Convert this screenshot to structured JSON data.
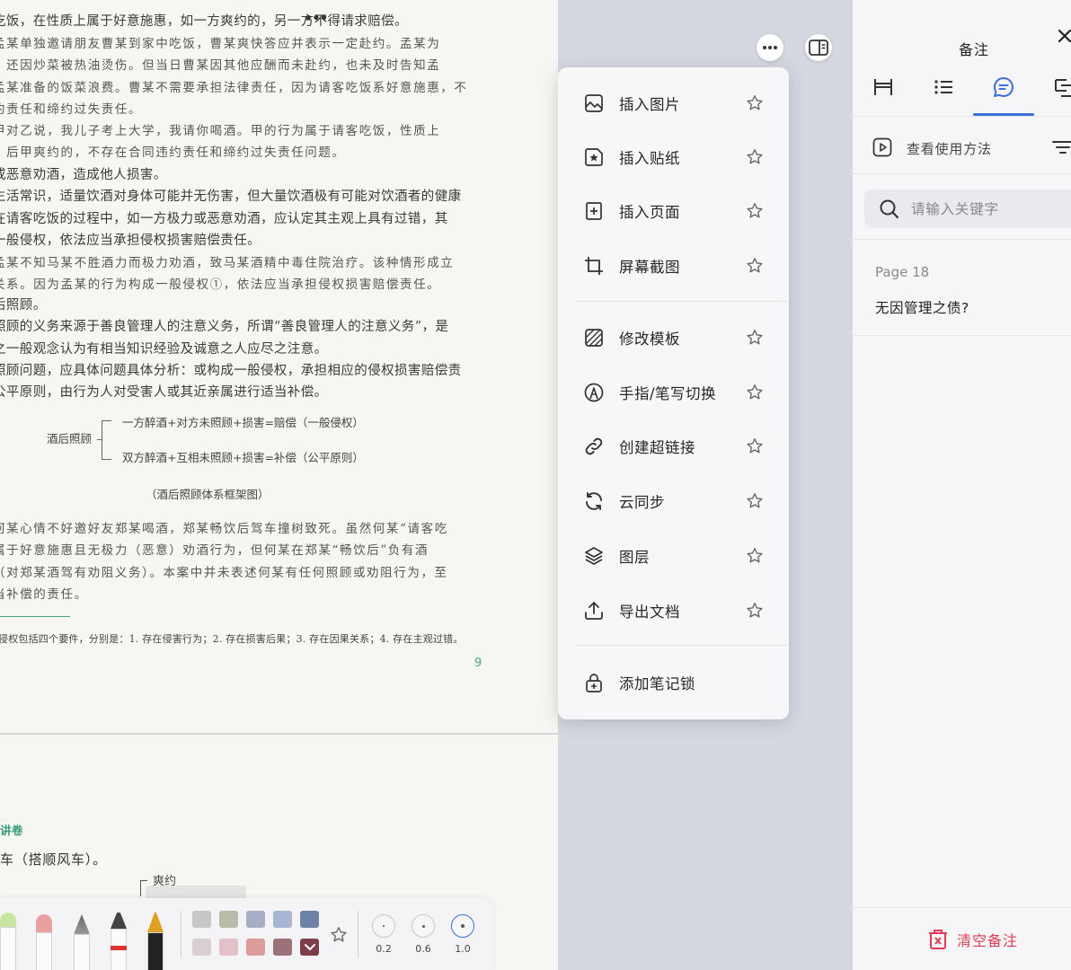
{
  "document": {
    "paragraphs": [
      {
        "text": "吃饭，在性质上属于好意施惠，如一方爽约的，另一方不得请求赔偿。",
        "hand": false
      },
      {
        "text": "孟某单独邀请朋友曹某到家中吃饭，曹某爽快答应并表示一定赴约。孟某为\n，还因炒菜被热油烫伤。但当日曹某因其他应酬而未赴约，也未及时告知孟\n孟某准备的饭菜浪费。曹某不需要承担法律责任，因为请客吃饭系好意施惠，不\n约责任和缔约过失责任。",
        "hand": true
      },
      {
        "text": "甲对乙说，我儿子考上大学，我请你喝酒。甲的行为属于请客吃饭，性质上\n。后甲爽约的，不存在合同违约责任和缔约过失责任问题。",
        "hand": true
      },
      {
        "text": "或恶意劝酒，造成他人损害。\n生活常识，适量饮酒对身体可能并无伤害，但大量饮酒极有可能对饮酒者的健康\n在请客吃饭的过程中，如一方极力或恶意劝酒，应认定其主观上具有过错，其\n一般侵权，依法应当承担侵权损害赔偿责任。",
        "hand": false
      },
      {
        "text": "孟某不知马某不胜酒力而极力劝酒，致马某酒精中毒住院治疗。该种情形成立\n关系。因为孟某的行为构成一般侵权①，依法应当承担侵权损害赔偿责任。",
        "hand": true
      },
      {
        "text": "后照顾。\n照顾的义务来源于善良管理人的注意义务，所谓“善良管理人的注意义务”，是\n之一般观念认为有相当知识经验及诚意之人应尽之注意。\n照顾问题，应具体问题具体分析：或构成一般侵权，承担相应的侵权损害赔偿责\n公平原则，由行为人对受害人或其近亲属进行适当补偿。",
        "hand": false
      },
      {
        "text": "何某心情不好邀好友郑某喝酒，郑某畅饮后驾车撞树致死。虽然何某“请客吃\n属于好意施惠且无极力（恶意）劝酒行为，但何某在郑某“畅饮后”负有酒\n（对郑某酒驾有劝阻义务）。本案中并未表述何某有任何照顾或劝阻行为，至\n当补偿的责任。",
        "hand": true
      }
    ],
    "diagram": {
      "root": "酒后照顾",
      "branch_a": "一方醉酒+对方未照顾+损害=赔偿（一般侵权）",
      "branch_b": "双方醉酒+互相未照顾+损害=补偿（公平原则）",
      "caption": "（酒后照顾体系框架图）"
    },
    "footnote": "侵权包括四个要件，分别是：1. 存在侵害行为；2. 存在损害后果；3. 存在因果关系；4. 存在主观过错。",
    "page_number": "9",
    "next_heading": "讲卷",
    "next_line": "车（搭顺风车）。",
    "margin_note": "爽约"
  },
  "pen_toolbar": {
    "colors_row1": [
      "#c7c7c7",
      "#b9bcab",
      "#a5aec4",
      "#a9b6d3",
      "#6d82a6"
    ],
    "colors_row2": [
      "#d7cfd3",
      "#e3c1c9",
      "#dd9c9c",
      "#9c7279",
      "#7c3f4a"
    ],
    "sizes": [
      "0.2",
      "0.6",
      "1.0"
    ],
    "selected_size": "1.0"
  },
  "context_menu": {
    "items": [
      {
        "label": "插入图片",
        "icon": "image-icon"
      },
      {
        "label": "插入贴纸",
        "icon": "sticker-icon"
      },
      {
        "label": "插入页面",
        "icon": "add-page-icon"
      },
      {
        "label": "屏幕截图",
        "icon": "crop-icon"
      },
      {
        "label": "修改模板",
        "icon": "template-icon"
      },
      {
        "label": "手指/笔写切换",
        "icon": "pen-switch-icon"
      },
      {
        "label": "创建超链接",
        "icon": "link-icon"
      },
      {
        "label": "云同步",
        "icon": "sync-icon"
      },
      {
        "label": "图层",
        "icon": "layers-icon"
      },
      {
        "label": "导出文档",
        "icon": "export-icon"
      },
      {
        "label": "添加笔记锁",
        "icon": "lock-icon"
      }
    ]
  },
  "sidebar": {
    "title": "备注",
    "tabs": [
      "bookmark-icon",
      "list-icon",
      "comment-icon",
      "outline-icon"
    ],
    "active_tab": 2,
    "howto_label": "查看使用方法",
    "search_placeholder": "请输入关键字",
    "notes": [
      {
        "page": "Page 18",
        "text": "无因管理之债?"
      }
    ],
    "clear_label": "清空备注",
    "accent": "#3d6fd8",
    "danger": "#e03b55"
  }
}
